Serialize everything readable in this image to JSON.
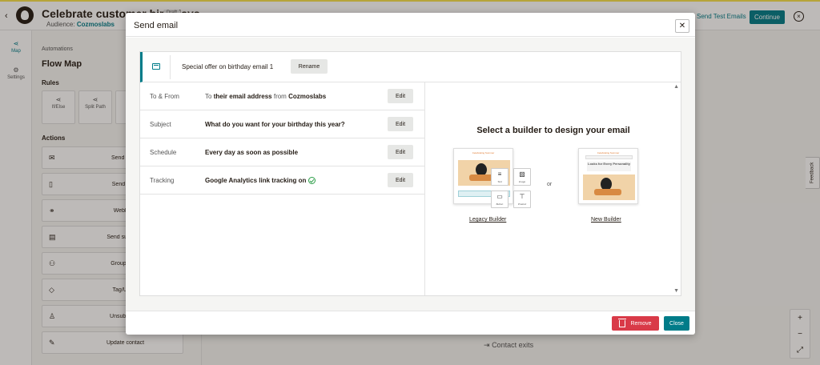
{
  "app": {
    "title": "Celebrate customer birthdays",
    "draft_badge": "Draft",
    "audience_label": "Audience:",
    "audience_value": "Cozmoslabs",
    "send_test": "Send Test Emails",
    "continue": "Continue"
  },
  "rail": {
    "map": "Map",
    "settings": "Settings"
  },
  "panel": {
    "breadcrumb": "Automations",
    "title": "Flow Map",
    "rules_heading": "Rules",
    "rules": [
      {
        "label": "If/Else"
      },
      {
        "label": "Split Path"
      },
      {
        "label": "W"
      }
    ],
    "actions_heading": "Actions",
    "actions": [
      {
        "label": "Send email"
      },
      {
        "label": "Send SMS"
      },
      {
        "label": "Webhook"
      },
      {
        "label": "Send survey in"
      },
      {
        "label": "Group/Ungr"
      },
      {
        "label": "Tag/Untag"
      },
      {
        "label": "Unsubscribe"
      },
      {
        "label": "Update contact"
      }
    ]
  },
  "canvas": {
    "contact_exits": "Contact exits",
    "feedback": "Feedback"
  },
  "modal": {
    "title": "Send email",
    "email_name": "Special offer on birthday email 1",
    "rename": "Rename",
    "rows": [
      {
        "label": "To & From",
        "value_prefix": "To",
        "value_strong": "their email address",
        "value_mid": "from",
        "value_strong2": "Cozmoslabs",
        "edit": "Edit"
      },
      {
        "label": "Subject",
        "value_strong": "What do you want for your birthday this year?",
        "edit": "Edit"
      },
      {
        "label": "Schedule",
        "value_strong": "Every day as soon as possible",
        "edit": "Edit"
      },
      {
        "label": "Tracking",
        "value_strong": "Google Analytics link tracking on",
        "edit": "Edit"
      }
    ],
    "builder_title": "Select a builder to design your email",
    "or": "or",
    "legacy_builder": "Legacy Builder",
    "new_builder": "New Builder",
    "legacy_thumb": {
      "header": "Celebrating Summer",
      "tools": [
        "Text",
        "Image",
        "Button",
        "Product"
      ]
    },
    "new_thumb": {
      "header": "Celebrating Summer",
      "heading": "Looks for Every Personality"
    },
    "remove": "Remove",
    "close": "Close"
  },
  "colors": {
    "accent": "#007c89",
    "danger": "#d93a48",
    "topbar_stripe": "#f5e04b"
  }
}
